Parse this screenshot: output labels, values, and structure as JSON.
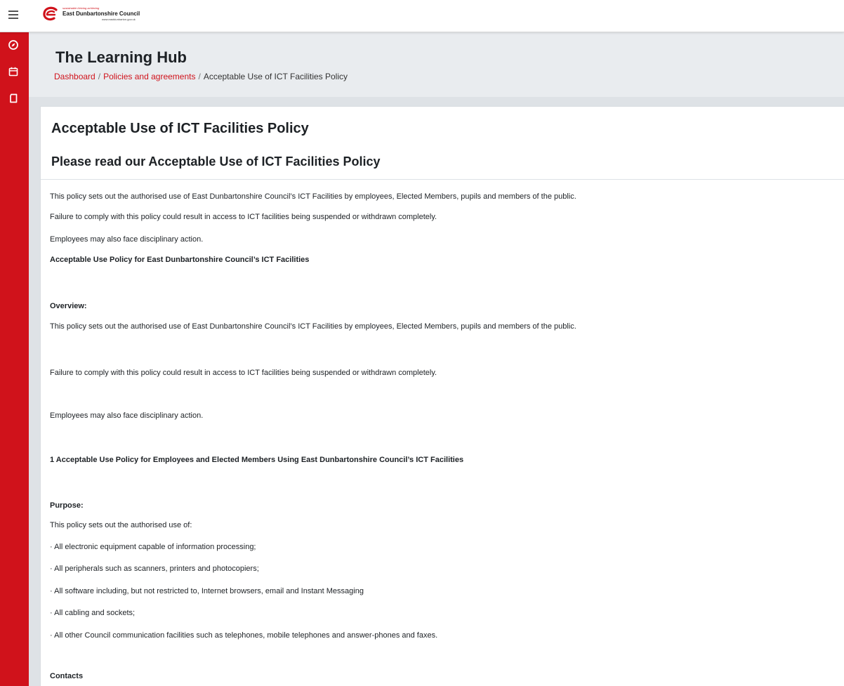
{
  "logo": {
    "tagline": "sustainable thriving achieving",
    "name": "East Dunbartonshire Council",
    "url": "www.eastdunbarton.gov.uk"
  },
  "header": {
    "title": "The Learning Hub",
    "breadcrumb": {
      "dashboard": "Dashboard",
      "policies": "Policies and agreements",
      "current": "Acceptable Use of ICT Facilities Policy",
      "separator": "/"
    }
  },
  "page": {
    "title": "Acceptable Use of ICT Facilities Policy",
    "section_title": "Please read our Acceptable Use of ICT Facilities Policy",
    "paragraphs": [
      "This policy sets out the authorised use of East Dunbartonshire Council’s ICT Facilities by employees, Elected Members, pupils and members of the public.",
      "Failure to comply with this policy could result in access to ICT facilities being suspended or withdrawn completely.",
      "Employees may also face disciplinary action.",
      "Acceptable Use Policy for East Dunbartonshire Council’s ICT Facilities",
      "Overview:",
      "This policy sets out the authorised use of East Dunbartonshire Council’s ICT Facilities by employees, Elected Members, pupils and members of the public.",
      "Failure to comply with this policy could result in access to ICT facilities being suspended or withdrawn completely.",
      "Employees may also face disciplinary action.",
      "1 Acceptable Use Policy for Employees and Elected Members Using East Dunbartonshire Council’s ICT Facilities",
      "Purpose:",
      "This policy sets out the authorised use of:",
      "· All electronic equipment capable of information processing;",
      "· All peripherals such as scanners, printers and photocopiers;",
      "· All software including, but not restricted to, Internet browsers, email and Instant Messaging",
      "· All cabling and sockets;",
      "· All other Council communication facilities such as telephones, mobile telephones and answer-phones and faxes.",
      "Contacts"
    ]
  },
  "icons": {
    "menu": "hamburger-icon",
    "sidebar": [
      "compass-icon",
      "calendar-icon",
      "book-icon"
    ]
  },
  "colors": {
    "brand_red": "#d0121b",
    "header_bg": "#e9ecef",
    "page_bg": "#dee2e6"
  }
}
